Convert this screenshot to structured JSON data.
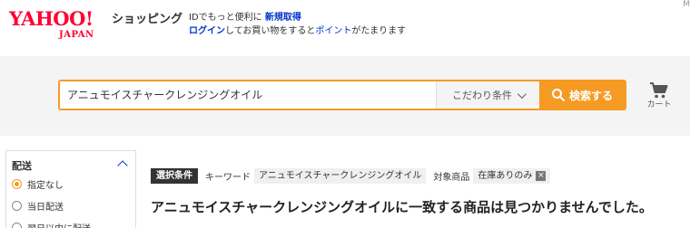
{
  "header": {
    "logo_main": "YAHOO!",
    "logo_sub": "JAPAN",
    "shop_label": "ショッピング",
    "promo_line1_prefix": "IDでもっと便利に",
    "promo_signup_link": "新規取得",
    "promo_login_link": "ログイン",
    "promo_line2_middle": "してお買い物をすると",
    "promo_point_link": "ポイント",
    "promo_line2_suffix": "がたまります",
    "corner_char": "M"
  },
  "search": {
    "query": "アニュモイスチャークレンジングオイル",
    "filter_label": "こだわり条件",
    "search_button": "検索する",
    "cart_label": "カート"
  },
  "sidebar": {
    "title": "配送",
    "options": [
      {
        "label": "指定なし",
        "selected": true
      },
      {
        "label": "当日配送",
        "selected": false
      },
      {
        "label": "翌日以内に配送",
        "selected": false
      }
    ]
  },
  "criteria": {
    "badge": "選択条件",
    "keyword_label": "キーワード",
    "keyword_value": "アニュモイスチャークレンジングオイル",
    "target_label": "対象商品",
    "target_value": "在庫ありのみ",
    "remove_symbol": "×"
  },
  "message": {
    "no_result": "アニュモイスチャークレンジングオイルに一致する商品は見つかりませんでした。"
  },
  "colors": {
    "brand_red": "#ff0033",
    "accent_orange": "#f59a23",
    "link_blue": "#0033cc"
  }
}
